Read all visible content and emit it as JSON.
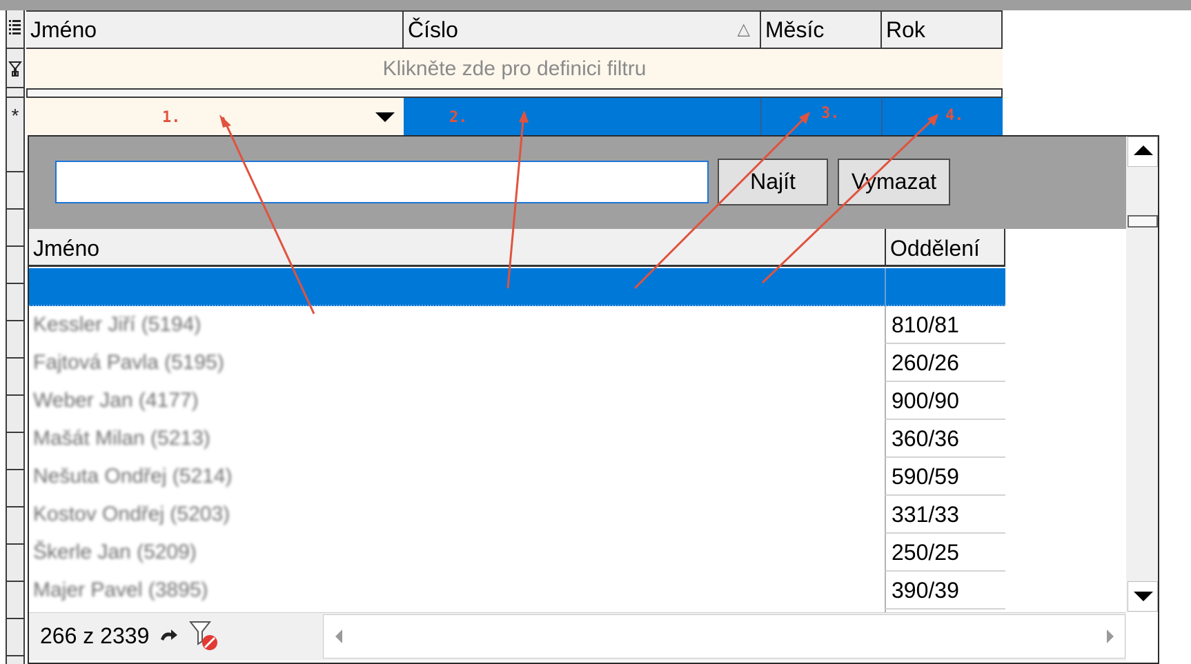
{
  "grid": {
    "columns": [
      "Jméno",
      "Číslo",
      "Měsíc",
      "Rok"
    ],
    "sort_indicator": "△",
    "filter_prompt": "Klikněte zde pro definici filtru",
    "new_row_marker": "*",
    "annotations": [
      "1.",
      "2.",
      "3.",
      "4."
    ]
  },
  "popup": {
    "search_value": "",
    "find_label": "Najít",
    "clear_label": "Vymazat",
    "columns": [
      "Jméno",
      "Oddělení"
    ],
    "rows": [
      {
        "name": "",
        "dept": ""
      },
      {
        "name": "Kessler Jiří (5194)",
        "dept": "810/81"
      },
      {
        "name": "Fajtová Pavla (5195)",
        "dept": "260/26"
      },
      {
        "name": "Weber Jan (4177)",
        "dept": "900/90"
      },
      {
        "name": "Mašát Milan (5213)",
        "dept": "360/36"
      },
      {
        "name": "Nešuta Ondřej (5214)",
        "dept": "590/59"
      },
      {
        "name": "Kostov Ondřej (5203)",
        "dept": "331/33"
      },
      {
        "name": "Škerle Jan (5209)",
        "dept": "250/25"
      },
      {
        "name": "Majer Pavel (3895)",
        "dept": "390/39"
      }
    ],
    "status_count": "266 z 2339"
  },
  "colors": {
    "selection": "#0078d7",
    "annotation": "#e0533f",
    "filter_row": "#fdf7ec"
  },
  "icons": [
    "column-chooser-icon",
    "filter-funnel-icon",
    "new-row-icon",
    "dropdown-arrow-icon",
    "redo-icon",
    "clear-filter-icon",
    "scroll-up-icon",
    "scroll-down-icon",
    "scroll-left-icon",
    "scroll-right-icon"
  ]
}
